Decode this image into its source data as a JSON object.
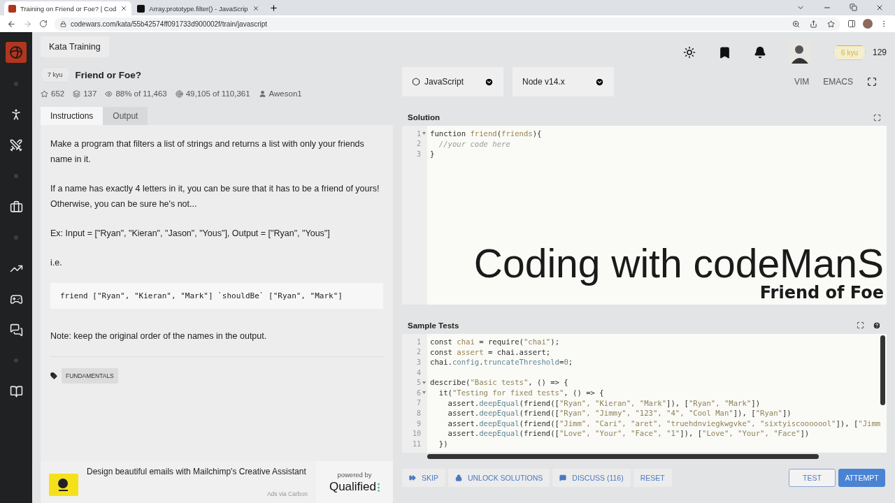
{
  "browser": {
    "tabs": [
      {
        "title": "Training on Friend or Foe? | Cod",
        "selected": true,
        "kind": "codewars"
      },
      {
        "title": "Array.prototype.filter() - JavaScrip",
        "selected": false,
        "kind": "mdn"
      }
    ],
    "url": "codewars.com/kata/55b42574ff091733d900002f/train/javascript"
  },
  "header": {
    "breadcrumb": "Kata Training",
    "rank": "6 kyu",
    "honor": "129"
  },
  "kata": {
    "rank": "7 kyu",
    "title": "Friend or Foe?",
    "stats": [
      {
        "kind": "stars",
        "text": "652"
      },
      {
        "kind": "collections",
        "text": "137"
      },
      {
        "kind": "satisfaction",
        "text": "88% of 11,463"
      },
      {
        "kind": "completions",
        "text": "49,105 of 110,361"
      },
      {
        "kind": "author",
        "text": "Aweson1"
      }
    ]
  },
  "panel_tabs": [
    {
      "label": "Instructions",
      "selected": true
    },
    {
      "label": "Output",
      "selected": false
    }
  ],
  "instructions": [
    {
      "kind": "text",
      "text": "Make a program that filters a list of strings and returns a list with only your friends name in it."
    },
    {
      "kind": "text",
      "text": "If a name has exactly 4 letters in it, you can be sure that it has to be a friend of yours! Otherwise, you can be sure he's not..."
    },
    {
      "kind": "text",
      "text": "Ex: Input = [\"Ryan\", \"Kieran\", \"Jason\", \"Yous\"], Output = [\"Ryan\", \"Yous\"]"
    },
    {
      "kind": "text",
      "text": "i.e."
    },
    {
      "kind": "code",
      "text": "friend [\"Ryan\", \"Kieran\", \"Mark\"] `shouldBe` [\"Ryan\", \"Mark\"]"
    },
    {
      "kind": "text",
      "text": "Note: keep the original order of the names in the output."
    }
  ],
  "tags": [
    "FUNDAMENTALS"
  ],
  "ad": {
    "text": "Design beautiful emails with Mailchimp's Creative Assistant",
    "meta": "Ads via Carbon",
    "sponsor_caption": "powered by",
    "sponsor": "Qualified"
  },
  "editor": {
    "language": "JavaScript",
    "version": "Node v14.x",
    "modes": [
      "VIM",
      "EMACS"
    ]
  },
  "solution": {
    "title": "Solution",
    "lines": [
      {
        "n": "1",
        "fold": true,
        "tokens": [
          {
            "kind": "plain",
            "text": "function "
          },
          {
            "kind": "name",
            "text": "friend"
          },
          {
            "kind": "plain",
            "text": "("
          },
          {
            "kind": "name",
            "text": "friends"
          },
          {
            "kind": "plain",
            "text": "){"
          }
        ]
      },
      {
        "n": "2",
        "fold": false,
        "tokens": [
          {
            "kind": "comment",
            "text": "  //your code here"
          }
        ]
      },
      {
        "n": "3",
        "fold": false,
        "tokens": [
          {
            "kind": "plain",
            "text": "}"
          }
        ]
      }
    ]
  },
  "video_overlay": {
    "title": "Coding with codeManS",
    "subtitle": "Friend of Foe"
  },
  "sample_tests": {
    "title": "Sample Tests",
    "lines": [
      {
        "n": "1",
        "fold": false,
        "tokens": [
          {
            "kind": "plain",
            "text": "const "
          },
          {
            "kind": "name",
            "text": "chai"
          },
          {
            "kind": "plain",
            "text": " = require("
          },
          {
            "kind": "string",
            "text": "\"chai\""
          },
          {
            "kind": "plain",
            "text": ");"
          }
        ]
      },
      {
        "n": "2",
        "fold": false,
        "tokens": [
          {
            "kind": "plain",
            "text": "const "
          },
          {
            "kind": "name",
            "text": "assert"
          },
          {
            "kind": "plain",
            "text": " = chai.assert;"
          }
        ]
      },
      {
        "n": "3",
        "fold": false,
        "tokens": [
          {
            "kind": "plain",
            "text": "chai."
          },
          {
            "kind": "property",
            "text": "config"
          },
          {
            "kind": "plain",
            "text": "."
          },
          {
            "kind": "property",
            "text": "truncateThreshold"
          },
          {
            "kind": "plain",
            "text": "="
          },
          {
            "kind": "property",
            "text": "0"
          },
          {
            "kind": "plain",
            "text": ";"
          }
        ]
      },
      {
        "n": "4",
        "fold": false
      },
      {
        "n": "5",
        "fold": true,
        "tokens": [
          {
            "kind": "plain",
            "text": "describe("
          },
          {
            "kind": "string",
            "text": "\"Basic tests\""
          },
          {
            "kind": "plain",
            "text": ", () => {"
          }
        ]
      },
      {
        "n": "6",
        "fold": true,
        "tokens": [
          {
            "kind": "plain",
            "text": "  it("
          },
          {
            "kind": "string",
            "text": "\"Testing for fixed tests\""
          },
          {
            "kind": "plain",
            "text": ", () => {"
          }
        ]
      },
      {
        "n": "7",
        "fold": false,
        "tokens": [
          {
            "kind": "plain",
            "text": "    assert."
          },
          {
            "kind": "property",
            "text": "deepEqual"
          },
          {
            "kind": "plain",
            "text": "(friend(["
          },
          {
            "kind": "string",
            "text": "\"Ryan\", \"Kieran\", \"Mark\""
          },
          {
            "kind": "plain",
            "text": "]), ["
          },
          {
            "kind": "string",
            "text": "\"Ryan\", \"Mark\""
          },
          {
            "kind": "plain",
            "text": "])"
          }
        ]
      },
      {
        "n": "8",
        "fold": false,
        "tokens": [
          {
            "kind": "plain",
            "text": "    assert."
          },
          {
            "kind": "property",
            "text": "deepEqual"
          },
          {
            "kind": "plain",
            "text": "(friend(["
          },
          {
            "kind": "string",
            "text": "\"Ryan\", \"Jimmy\", \"123\", \"4\", \"Cool Man\""
          },
          {
            "kind": "plain",
            "text": "]), ["
          },
          {
            "kind": "string",
            "text": "\"Ryan\""
          },
          {
            "kind": "plain",
            "text": "])"
          }
        ]
      },
      {
        "n": "9",
        "fold": false,
        "tokens": [
          {
            "kind": "plain",
            "text": "    assert."
          },
          {
            "kind": "property",
            "text": "deepEqual"
          },
          {
            "kind": "plain",
            "text": "(friend(["
          },
          {
            "kind": "string",
            "text": "\"Jimm\", \"Cari\", \"aret\", \"truehdnviegkwgvke\", \"sixtyiscooooool\""
          },
          {
            "kind": "plain",
            "text": "]), ["
          },
          {
            "kind": "string",
            "text": "\"Jimm"
          }
        ]
      },
      {
        "n": "10",
        "fold": false,
        "tokens": [
          {
            "kind": "plain",
            "text": "    assert."
          },
          {
            "kind": "property",
            "text": "deepEqual"
          },
          {
            "kind": "plain",
            "text": "(friend(["
          },
          {
            "kind": "string",
            "text": "\"Love\", \"Your\", \"Face\", \"1\""
          },
          {
            "kind": "plain",
            "text": "]), ["
          },
          {
            "kind": "string",
            "text": "\"Love\", \"Your\", \"Face\""
          },
          {
            "kind": "plain",
            "text": "])"
          }
        ]
      },
      {
        "n": "11",
        "fold": false,
        "tokens": [
          {
            "kind": "plain",
            "text": "  })"
          }
        ]
      }
    ]
  },
  "actions": [
    {
      "label": "SKIP",
      "kind": "skip"
    },
    {
      "label": "UNLOCK SOLUTIONS",
      "kind": "unlock"
    },
    {
      "label": "DISCUSS (116)",
      "kind": "discuss"
    },
    {
      "label": "RESET",
      "kind": "reset"
    }
  ],
  "submit": [
    {
      "label": "TEST",
      "kind": "outline"
    },
    {
      "label": "ATTEMPT",
      "kind": "primary"
    }
  ]
}
